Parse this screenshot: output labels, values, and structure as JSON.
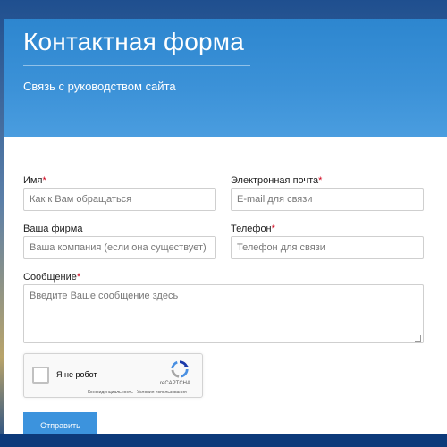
{
  "header": {
    "title": "Контактная форма",
    "subtitle": "Связь с руководством сайта"
  },
  "form": {
    "name": {
      "label": "Имя",
      "required_mark": "*",
      "placeholder": "Как к Вам обращаться",
      "value": ""
    },
    "email": {
      "label": "Электронная почта",
      "required_mark": "*",
      "placeholder": "E-mail для связи",
      "value": ""
    },
    "company": {
      "label": "Ваша фирма",
      "placeholder": "Ваша компания (если она существует)",
      "value": ""
    },
    "phone": {
      "label": "Телефон",
      "required_mark": "*",
      "placeholder": "Телефон для связи",
      "value": ""
    },
    "message": {
      "label": "Сообщение",
      "required_mark": "*",
      "placeholder": "Введите Ваше сообщение здесь",
      "value": ""
    }
  },
  "captcha": {
    "checkbox_label": "Я не робот",
    "brand": "reCAPTCHA",
    "links": "Конфиденциальность - Условия использования",
    "checked": false
  },
  "submit_label": "Отправить",
  "colors": {
    "header_blue": "#3c92d8",
    "button_blue": "#3c93dd",
    "required_red": "#d0021b"
  }
}
